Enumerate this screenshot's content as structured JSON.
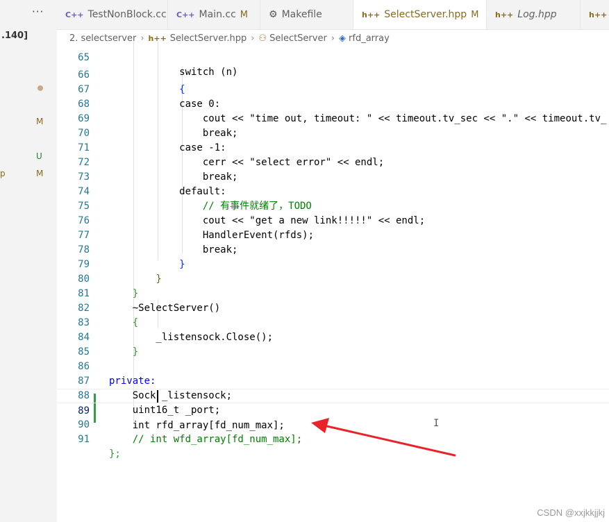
{
  "sidebar": {
    "more_label": "···",
    "host_label": ".140]",
    "rows": [
      {
        "left": "",
        "badge": "",
        "dot": true
      },
      {
        "left": "",
        "badge": "M"
      },
      {
        "left": "",
        "badge": "U"
      },
      {
        "left": "p",
        "badge": "M"
      }
    ],
    "colors": {
      "modified": "#8a6a1a",
      "untracked": "#2e7d32"
    }
  },
  "tabs": [
    {
      "icon": "C++",
      "label": "TestNonBlock.cc",
      "modified": ""
    },
    {
      "icon": "C++",
      "label": "Main.cc",
      "modified": "M"
    },
    {
      "icon": "makefile-icon",
      "label": "Makefile",
      "modified": ""
    },
    {
      "icon": "h++",
      "label": "SelectServer.hpp",
      "modified": "M",
      "active": true,
      "dirty": true
    },
    {
      "icon": "h++",
      "label": "Log.hpp",
      "modified": ""
    },
    {
      "icon": "h++",
      "label": "",
      "modified": ""
    }
  ],
  "breadcrumb": {
    "folder": "2. selectserver",
    "file_icon": "h++",
    "file": "SelectServer.hpp",
    "class": "SelectServer",
    "member": "rfd_array"
  },
  "editor": {
    "lines": [
      {
        "n": "65",
        "text": "            switch (n)"
      },
      {
        "n": "66",
        "text": "            {"
      },
      {
        "n": "67",
        "text": "            case 0:"
      },
      {
        "n": "68",
        "text": "                cout << \"time out, timeout: \" << timeout.tv_sec << \".\" << timeout.tv_"
      },
      {
        "n": "69",
        "text": "                break;"
      },
      {
        "n": "70",
        "text": "            case -1:"
      },
      {
        "n": "71",
        "text": "                cerr << \"select error\" << endl;"
      },
      {
        "n": "72",
        "text": "                break;"
      },
      {
        "n": "73",
        "text": "            default:"
      },
      {
        "n": "74",
        "text": "                // 有事件就绪了，TODO"
      },
      {
        "n": "75",
        "text": "                cout << \"get a new link!!!!!\" << endl;"
      },
      {
        "n": "76",
        "text": "                HandlerEvent(rfds);"
      },
      {
        "n": "77",
        "text": "                break;"
      },
      {
        "n": "78",
        "text": "            }"
      },
      {
        "n": "79",
        "text": "        }"
      },
      {
        "n": "80",
        "text": "    }"
      },
      {
        "n": "81",
        "text": "    ~SelectServer()"
      },
      {
        "n": "82",
        "text": "    {"
      },
      {
        "n": "83",
        "text": "        _listensock.Close();"
      },
      {
        "n": "84",
        "text": "    }"
      },
      {
        "n": "85",
        "text": ""
      },
      {
        "n": "86",
        "text": "private:"
      },
      {
        "n": "87",
        "text": "    Sock _listensock;"
      },
      {
        "n": "88",
        "text": "    uint16_t _port;"
      },
      {
        "n": "89",
        "text": "    int rfd_array[fd_num_max];"
      },
      {
        "n": "90",
        "text": "    // int wfd_array[fd_num_max];"
      },
      {
        "n": "91",
        "text": "};"
      }
    ]
  },
  "annotation": {
    "arrow_color": "#e8242a"
  },
  "watermark": "CSDN @xxjkkjjkj"
}
